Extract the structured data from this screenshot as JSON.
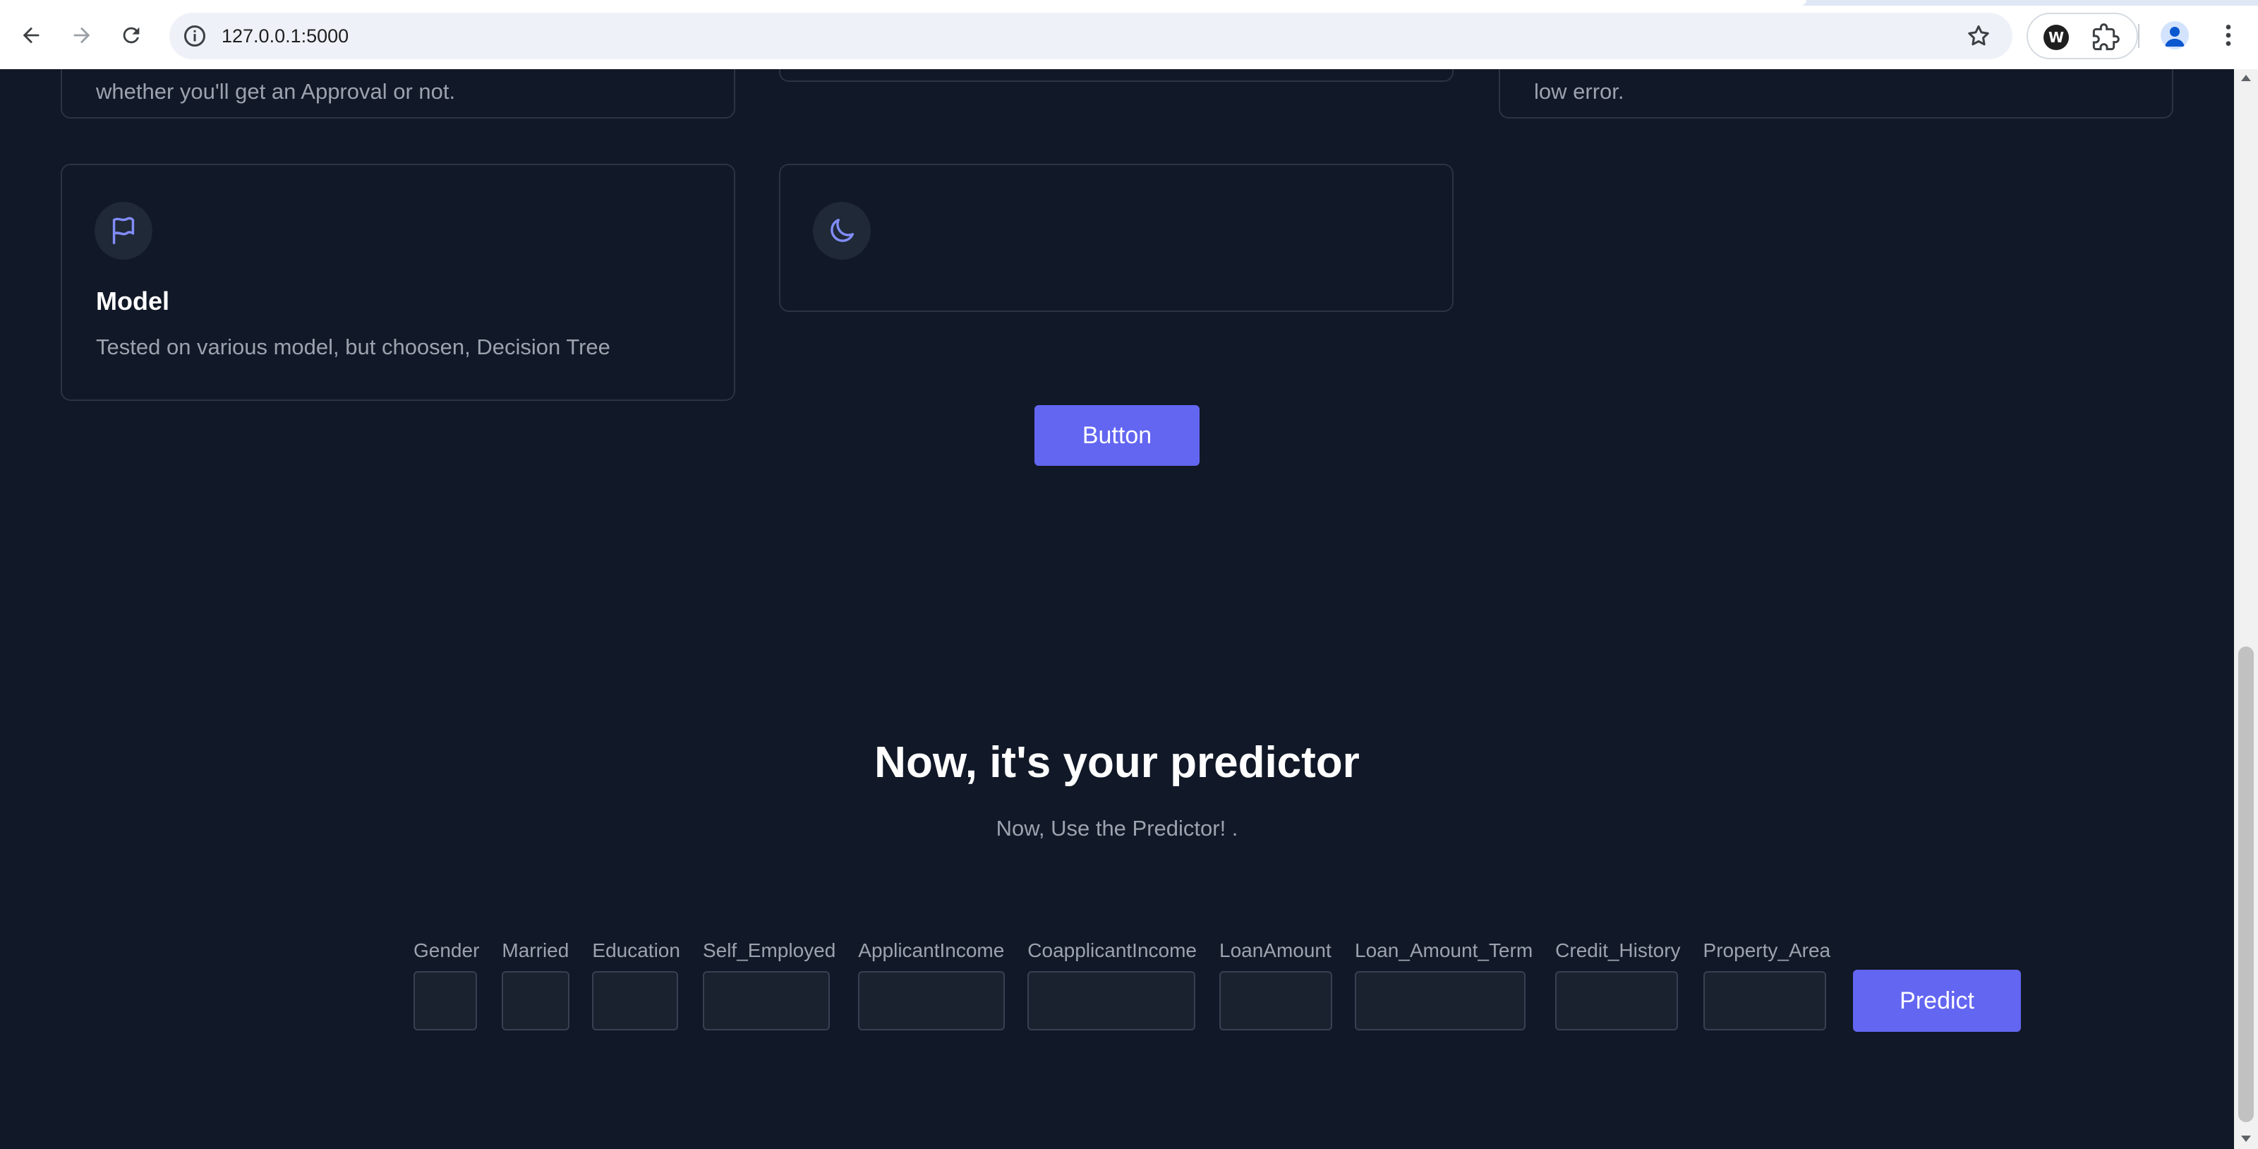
{
  "browser": {
    "url": "127.0.0.1:5000",
    "extension_letter": "W"
  },
  "cards": {
    "top_left_partial": "whether you'll get an Approval or not.",
    "top_right_partial": "low error.",
    "model_title": "Model",
    "model_desc": "Tested on various model, but choosen, Decision Tree"
  },
  "main_button_label": "Button",
  "predictor": {
    "title": "Now, it's your predictor",
    "subtitle": "Now, Use the Predictor! .",
    "fields": [
      {
        "label": "Gender",
        "value": ""
      },
      {
        "label": "Married",
        "value": ""
      },
      {
        "label": "Education",
        "value": ""
      },
      {
        "label": "Self_Employed",
        "value": ""
      },
      {
        "label": "ApplicantIncome",
        "value": ""
      },
      {
        "label": "CoapplicantIncome",
        "value": ""
      },
      {
        "label": "LoanAmount",
        "value": ""
      },
      {
        "label": "Loan_Amount_Term",
        "value": ""
      },
      {
        "label": "Credit_History",
        "value": ""
      },
      {
        "label": "Property_Area",
        "value": ""
      }
    ],
    "submit_label": "Predict"
  },
  "colors": {
    "page_bg": "#111827",
    "accent": "#6366f1",
    "card_border": "#2b3444",
    "muted_text": "#9ca3af"
  }
}
